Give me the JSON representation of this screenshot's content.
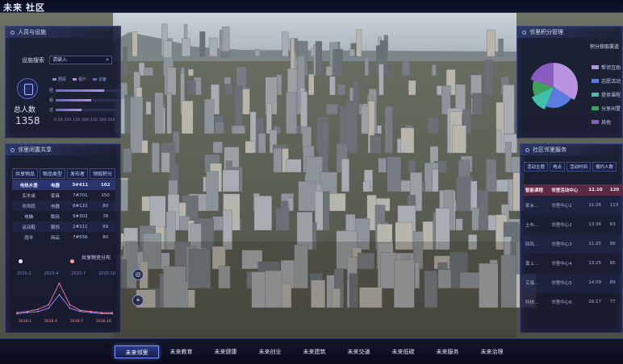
{
  "header": {
    "title": "未来 社区"
  },
  "people_panel": {
    "title": "人员与设施",
    "search_label": "设施搜索",
    "search_placeholder": "请输入",
    "legend": [
      "居民",
      "租户",
      "访客"
    ],
    "bars": [
      {
        "label": "居",
        "value": 0.75
      },
      {
        "label": "租",
        "value": 0.55
      },
      {
        "label": "访",
        "value": 0.4
      }
    ],
    "axis_ticks": "0 50 100 150 200 250 300 350",
    "total_label": "总人数",
    "total_value": "1358"
  },
  "share_panel": {
    "title": "邻里闲置共享",
    "tabs": [
      "共享物品",
      "物品类型",
      "发布者",
      "领取积分"
    ],
    "rows": [
      [
        "电热水壶",
        "电器",
        "3#411",
        "102"
      ],
      [
        "实木桌",
        "家具",
        "7#701",
        "150"
      ],
      [
        "吹风机",
        "电器",
        "8#122",
        "80"
      ],
      [
        "电脑",
        "数码",
        "9#302",
        "78"
      ],
      [
        "运动鞋",
        "服饰",
        "2#111",
        "89"
      ],
      [
        "雨伞",
        "用品",
        "7#556",
        "80"
      ]
    ],
    "chart_title": "共享物资分布",
    "years": [
      "2015-1",
      "2015-4",
      "2015-7",
      "2015-10"
    ]
  },
  "chart_data": {
    "type": "line",
    "x": [
      "2016-1",
      "2016-4",
      "2016-7",
      "2016-10"
    ],
    "series": [
      {
        "name": "",
        "values": [
          2,
          3,
          5,
          9,
          28,
          9,
          4,
          3,
          2,
          2
        ]
      },
      {
        "name": "",
        "values": [
          1,
          2,
          3,
          6,
          18,
          6,
          3,
          2,
          1,
          1
        ]
      }
    ],
    "title": "",
    "xlabel": "",
    "ylabel": ""
  },
  "points_panel": {
    "title": "邻里积分管理",
    "subtitle": "积分获取渠道",
    "legend": [
      {
        "label": "帮邻互助",
        "color": "#b894e0"
      },
      {
        "label": "志愿活动",
        "color": "#5a7be0"
      },
      {
        "label": "提供课程",
        "color": "#3fc0a8"
      },
      {
        "label": "分享闲置",
        "color": "#40a060"
      },
      {
        "label": "其他",
        "color": "#8a5cc0"
      }
    ],
    "slices": [
      0.34,
      0.22,
      0.12,
      0.12,
      0.2
    ]
  },
  "service_panel": {
    "title": "社区邻里服务",
    "headers": [
      "活动主题",
      "地点",
      "活动时间",
      "报约人数"
    ],
    "rows": [
      [
        "智能课程",
        "邻里活动中心",
        "12.10",
        "120"
      ],
      [
        "家乡...",
        "邻里中心1",
        "11:26",
        "123"
      ],
      [
        "土布...",
        "邻里中心2",
        "13:34",
        "63"
      ],
      [
        "回风...",
        "邻里中心3",
        "11:25",
        "86"
      ],
      [
        "黄上...",
        "邻里中心4",
        "13:25",
        "85"
      ],
      [
        "艾滋...",
        "邻里中心5",
        "14:39",
        "89"
      ],
      [
        "科技...",
        "邻里中心6",
        "16:17",
        "77"
      ]
    ]
  },
  "map_controls": [
    "定位",
    "标记"
  ],
  "nav": {
    "items": [
      "未来邻里",
      "未来教育",
      "未来健康",
      "未来创业",
      "未来建筑",
      "未来交通",
      "未来低碳",
      "未来服务",
      "未来治理"
    ],
    "active_index": 0
  }
}
